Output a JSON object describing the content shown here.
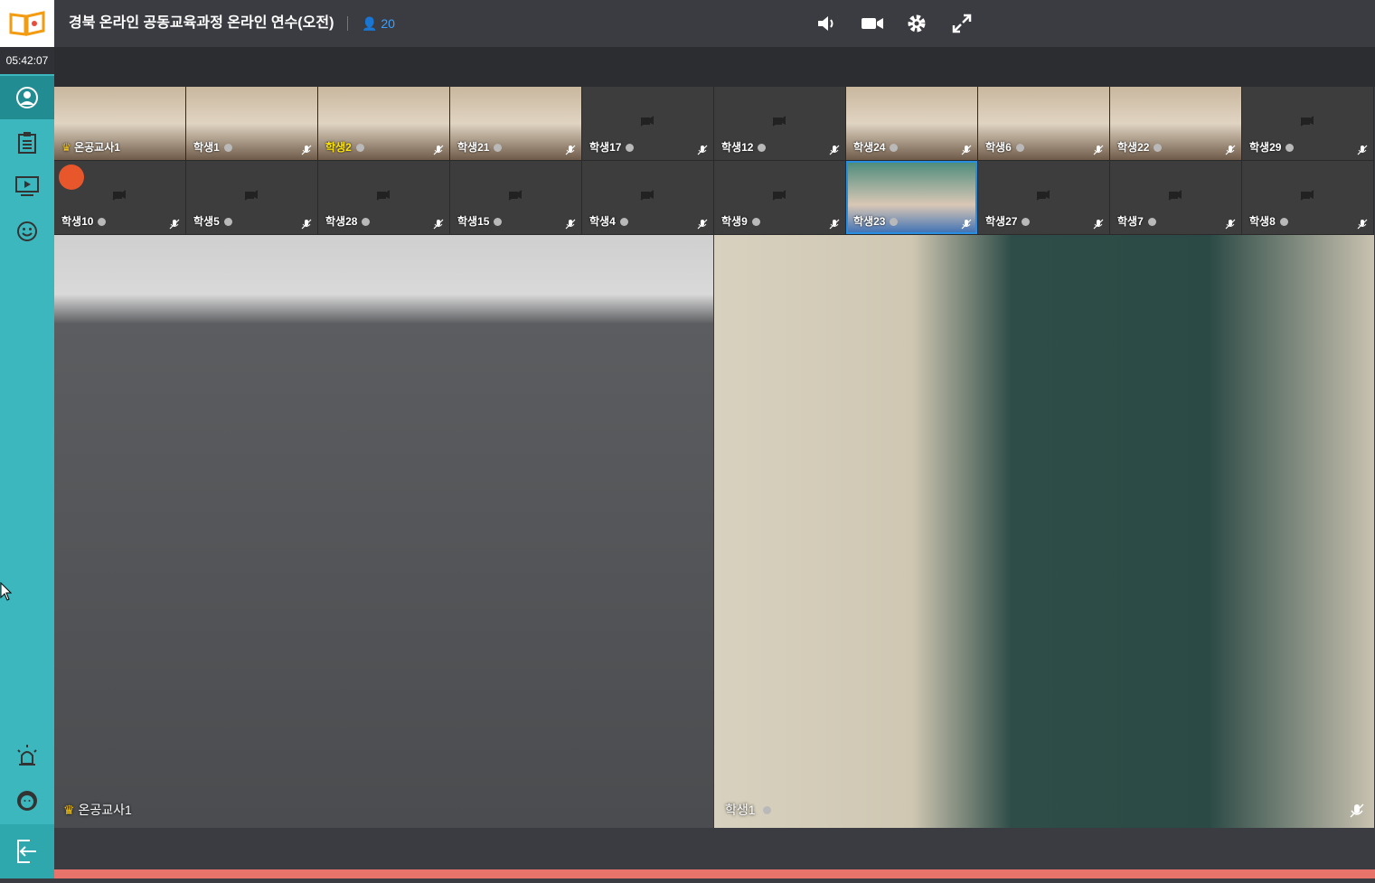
{
  "app": {
    "title": "경북 온라인 공동교육과정 온라인 연수(오전)",
    "participant_count": "20",
    "clock": "05:42:07"
  },
  "sidebar": {
    "items": [
      {
        "icon": "profile-icon"
      },
      {
        "icon": "clipboard-icon"
      },
      {
        "icon": "screen-share-icon"
      },
      {
        "icon": "smiley-icon"
      },
      {
        "icon": "alarm-icon"
      },
      {
        "icon": "user-avatar-icon"
      },
      {
        "icon": "exit-icon"
      }
    ]
  },
  "toolbar": {
    "controls": [
      {
        "icon": "speaker-icon"
      },
      {
        "icon": "video-camera-icon"
      },
      {
        "icon": "settings-icon"
      },
      {
        "icon": "fullscreen-icon"
      }
    ]
  },
  "participants_row1": [
    {
      "name": "온공교사1",
      "video": true,
      "teacher": true
    },
    {
      "name": "학생1",
      "video": true
    },
    {
      "name": "학생2",
      "video": true,
      "highlight": true
    },
    {
      "name": "학생21",
      "video": true
    },
    {
      "name": "학생17",
      "video": false
    },
    {
      "name": "학생12",
      "video": false
    },
    {
      "name": "학생24",
      "video": true
    },
    {
      "name": "학생6",
      "video": true
    },
    {
      "name": "학생22",
      "video": true
    },
    {
      "name": "학생29",
      "video": false
    }
  ],
  "participants_row2": [
    {
      "name": "학생10",
      "video": false
    },
    {
      "name": "학생5",
      "video": false
    },
    {
      "name": "학생28",
      "video": false
    },
    {
      "name": "학생15",
      "video": false
    },
    {
      "name": "학생4",
      "video": false
    },
    {
      "name": "학생9",
      "video": false
    },
    {
      "name": "학생23",
      "video": true,
      "selected": true
    },
    {
      "name": "학생27",
      "video": false
    },
    {
      "name": "학생7",
      "video": false
    },
    {
      "name": "학생8",
      "video": false
    }
  ],
  "main_left": {
    "name": "온공교사1"
  },
  "main_right": {
    "name": "학생1"
  }
}
